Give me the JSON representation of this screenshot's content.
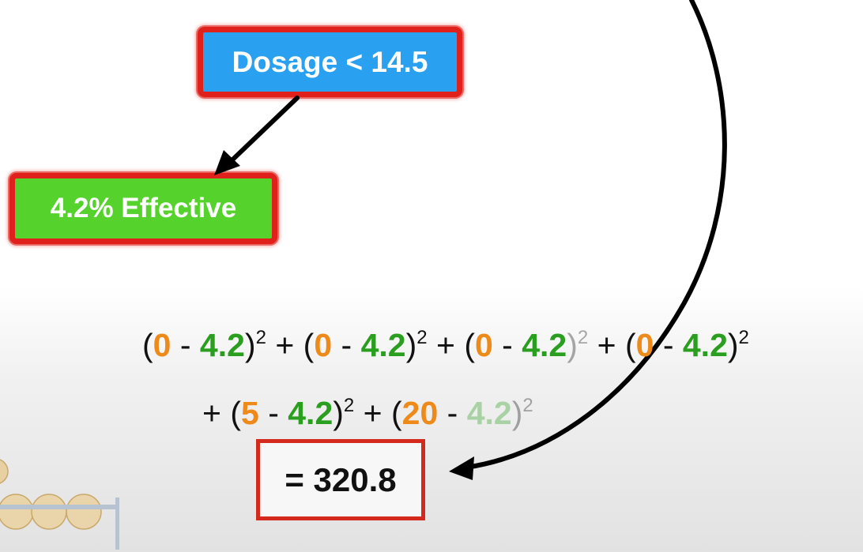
{
  "tree": {
    "root_node": {
      "label": "Dosage < 14.5",
      "color": "#2aa0f0"
    },
    "leaf_node": {
      "label": "4.2% Effective",
      "color": "#55d22c"
    },
    "highlight_color": "#e0201b"
  },
  "equation": {
    "observed_color": "#ed8a1a",
    "predicted_color": "#2a9e1f",
    "open_paren": "(",
    "close_paren": ")",
    "minus": " - ",
    "plus_between": " + ",
    "leading_plus": "+ ",
    "exponent": "2",
    "predicted": "4.2",
    "terms_line1": [
      {
        "observed": "0"
      },
      {
        "observed": "0"
      },
      {
        "observed": "0"
      },
      {
        "observed": "0"
      }
    ],
    "terms_line2": [
      {
        "observed": "5"
      },
      {
        "observed": "20"
      }
    ]
  },
  "result": {
    "label": "= 320.8"
  }
}
